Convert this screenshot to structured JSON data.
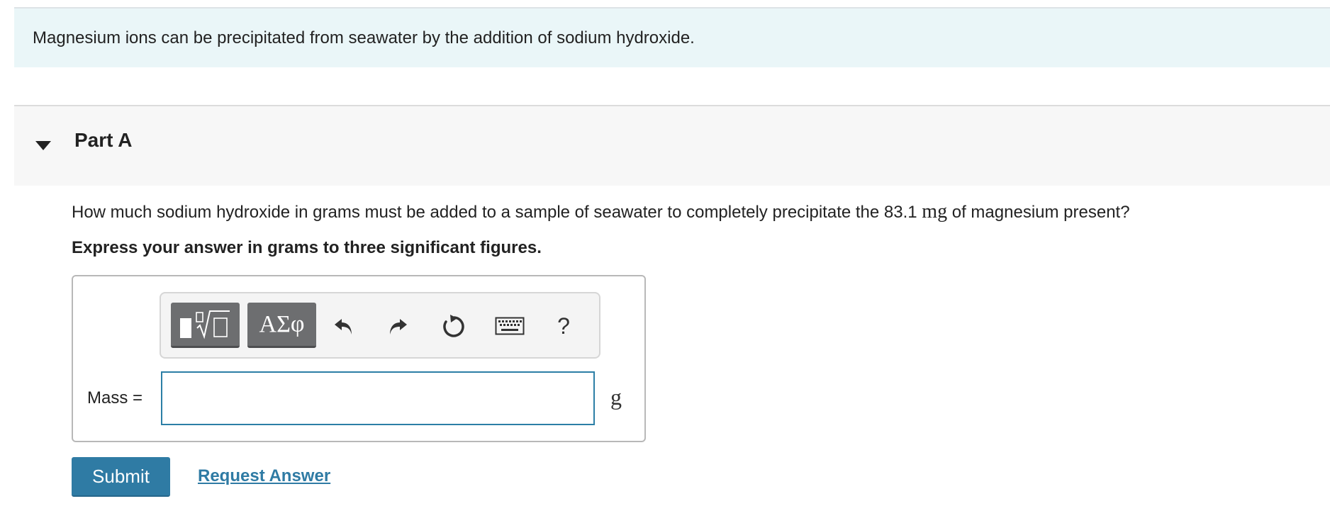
{
  "intro": {
    "text": "Magnesium ions can be precipitated from seawater by the addition of sodium hydroxide."
  },
  "part": {
    "title": "Part A",
    "expanded": true
  },
  "question": {
    "text_before": "How much sodium hydroxide in grams must be added to a sample of seawater to completely precipitate the 83.1 ",
    "unit": "mg",
    "text_after": " of magnesium present?",
    "instruction": "Express your answer in grams to three significant figures."
  },
  "toolbar": {
    "templates_icon": "templates-icon",
    "symbols_label": "ΑΣφ",
    "undo_icon": "undo-icon",
    "redo_icon": "redo-icon",
    "reset_icon": "reset-icon",
    "keyboard_icon": "keyboard-icon",
    "help_label": "?"
  },
  "answer": {
    "label": "Mass =",
    "value": "",
    "unit": "g"
  },
  "actions": {
    "submit_label": "Submit",
    "request_answer_label": "Request Answer"
  },
  "colors": {
    "intro_bg": "#eaf6f8",
    "accent": "#2f7ba4",
    "toolbar_button": "#6d6e70"
  }
}
